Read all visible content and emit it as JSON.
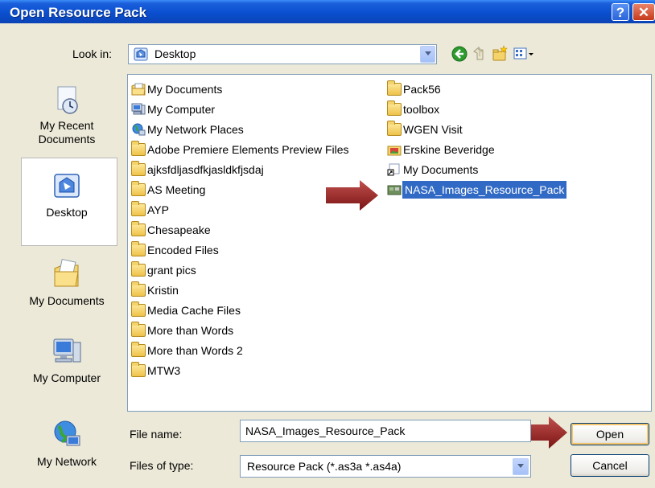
{
  "window": {
    "title": "Open Resource Pack",
    "help_label": "?",
    "close_label": "✕"
  },
  "lookin": {
    "label": "Look in:",
    "value": "Desktop"
  },
  "toolbar": [
    "back-icon",
    "up-folder-icon",
    "new-folder-icon",
    "views-menu-icon"
  ],
  "places": [
    {
      "label": "My Recent\nDocuments",
      "icon": "recent-documents-icon"
    },
    {
      "label": "Desktop",
      "icon": "desktop-icon",
      "selected": true
    },
    {
      "label": "My Documents",
      "icon": "my-documents-icon"
    },
    {
      "label": "My Computer",
      "icon": "my-computer-icon"
    },
    {
      "label": "My Network",
      "icon": "my-network-icon"
    }
  ],
  "files": {
    "col1": [
      {
        "name": "My Documents",
        "icon": "my-documents-icon"
      },
      {
        "name": "My Computer",
        "icon": "my-computer-icon"
      },
      {
        "name": "My Network Places",
        "icon": "network-places-icon"
      },
      {
        "name": "Adobe Premiere Elements Preview Files",
        "icon": "folder-icon"
      },
      {
        "name": "ajksfdljasdfkjasldkfjsdaj",
        "icon": "folder-icon"
      },
      {
        "name": "AS Meeting",
        "icon": "folder-icon"
      },
      {
        "name": "AYP",
        "icon": "folder-icon"
      },
      {
        "name": "Chesapeake",
        "icon": "folder-icon"
      },
      {
        "name": "Encoded Files",
        "icon": "folder-icon"
      },
      {
        "name": "grant pics",
        "icon": "folder-icon"
      },
      {
        "name": "Kristin",
        "icon": "folder-icon"
      },
      {
        "name": "Media Cache Files",
        "icon": "folder-icon"
      },
      {
        "name": "More than Words",
        "icon": "folder-icon"
      },
      {
        "name": "More than Words 2",
        "icon": "folder-icon"
      },
      {
        "name": "MTW3",
        "icon": "folder-icon"
      }
    ],
    "col2": [
      {
        "name": "Pack56",
        "icon": "folder-icon"
      },
      {
        "name": "toolbox",
        "icon": "folder-icon"
      },
      {
        "name": "WGEN Visit",
        "icon": "folder-icon"
      },
      {
        "name": "Erskine Beveridge",
        "icon": "image-folder-icon"
      },
      {
        "name": "My Documents",
        "icon": "shortcut-icon"
      },
      {
        "name": "NASA_Images_Resource_Pack",
        "icon": "resource-pack-icon",
        "selected": true
      }
    ]
  },
  "filename": {
    "label": "File name:",
    "value": "NASA_Images_Resource_Pack"
  },
  "filetype": {
    "label": "Files of type:",
    "value": "Resource Pack (*.as3a *.as4a)"
  },
  "buttons": {
    "open": "Open",
    "cancel": "Cancel"
  },
  "colors": {
    "titlebar": "#0a4fd0",
    "selection": "#316ac5",
    "pointer_arrow": "#8b1a1a"
  }
}
